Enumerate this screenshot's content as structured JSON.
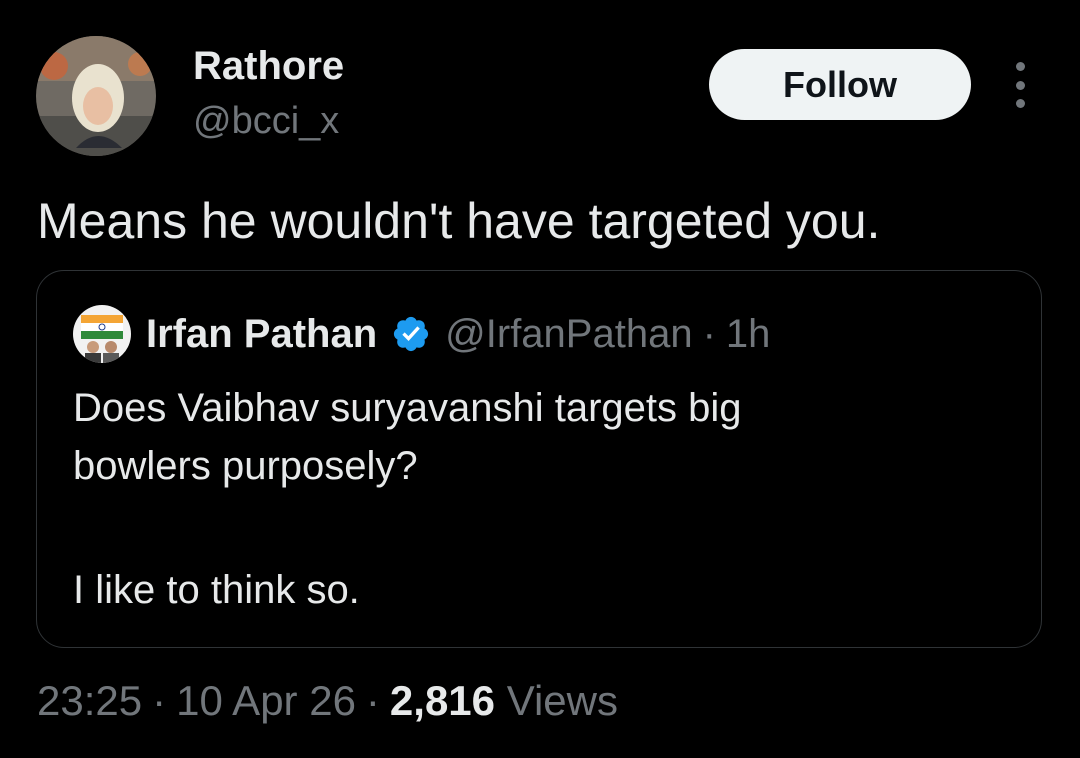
{
  "author": {
    "display_name": "Rathore",
    "handle": "@bcci_x",
    "avatar_icon": "user-photo-avatar",
    "follow_label": "Follow",
    "more_icon": "more-options-icon"
  },
  "tweet": {
    "text": "Means he wouldn't have targeted you."
  },
  "quote": {
    "display_name": "Irfan Pathan",
    "verified_icon": "verified-badge-icon",
    "handle": "@IrfanPathan",
    "separator": "·",
    "time": "1h",
    "lines": [
      "Does Vaibhav suryavanshi targets big",
      "bowlers purposely?",
      "I like to think so."
    ]
  },
  "meta": {
    "time": "23:25",
    "separator": "·",
    "date": "10 Apr 26",
    "views_count": "2,816",
    "views_label": "Views"
  },
  "colors": {
    "background": "#000000",
    "primary_text": "#e7e9ea",
    "secondary_text": "#71767b",
    "border": "#2f3336",
    "follow_bg": "#eff3f4",
    "verified": "#1d9bf0"
  }
}
